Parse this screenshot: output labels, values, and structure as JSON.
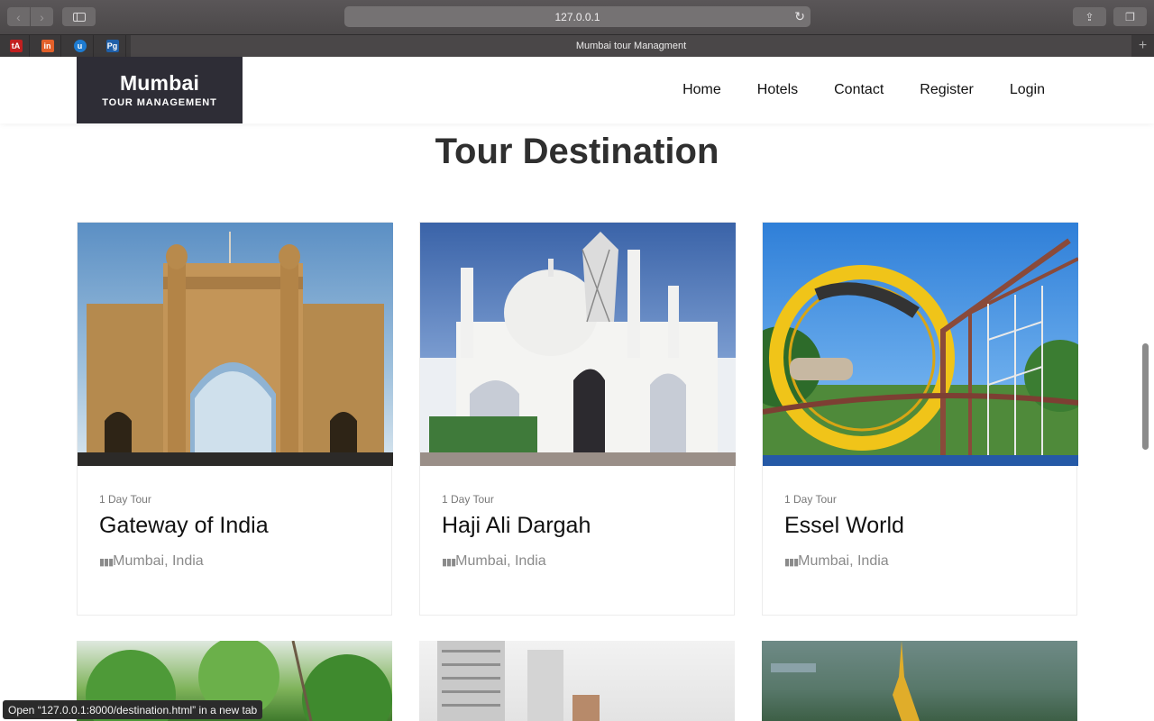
{
  "browser": {
    "url": "127.0.0.1",
    "tab_title": "Mumbai tour Managment",
    "status_text": "Open “127.0.0.1:8000/destination.html” in a new tab"
  },
  "favorites": [
    {
      "label": "tA",
      "color": "#c21f1f"
    },
    {
      "label": "in",
      "color": "#e2602a"
    },
    {
      "label": "u",
      "color": "#1d7bd1"
    },
    {
      "label": "Pg",
      "color": "#1f5fa8"
    }
  ],
  "site": {
    "logo_main": "Mumbai",
    "logo_sub": "TOUR MANAGEMENT",
    "menu": [
      "Home",
      "Hotels",
      "Contact",
      "Register",
      "Login"
    ]
  },
  "section": {
    "title": "Tour Destination"
  },
  "destinations": [
    {
      "tag": "1 Day Tour",
      "title": "Gateway of India",
      "location": "Mumbai, India"
    },
    {
      "tag": "1 Day Tour",
      "title": "Haji Ali Dargah",
      "location": "Mumbai, India"
    },
    {
      "tag": "1 Day Tour",
      "title": "Essel World",
      "location": "Mumbai, India"
    }
  ]
}
